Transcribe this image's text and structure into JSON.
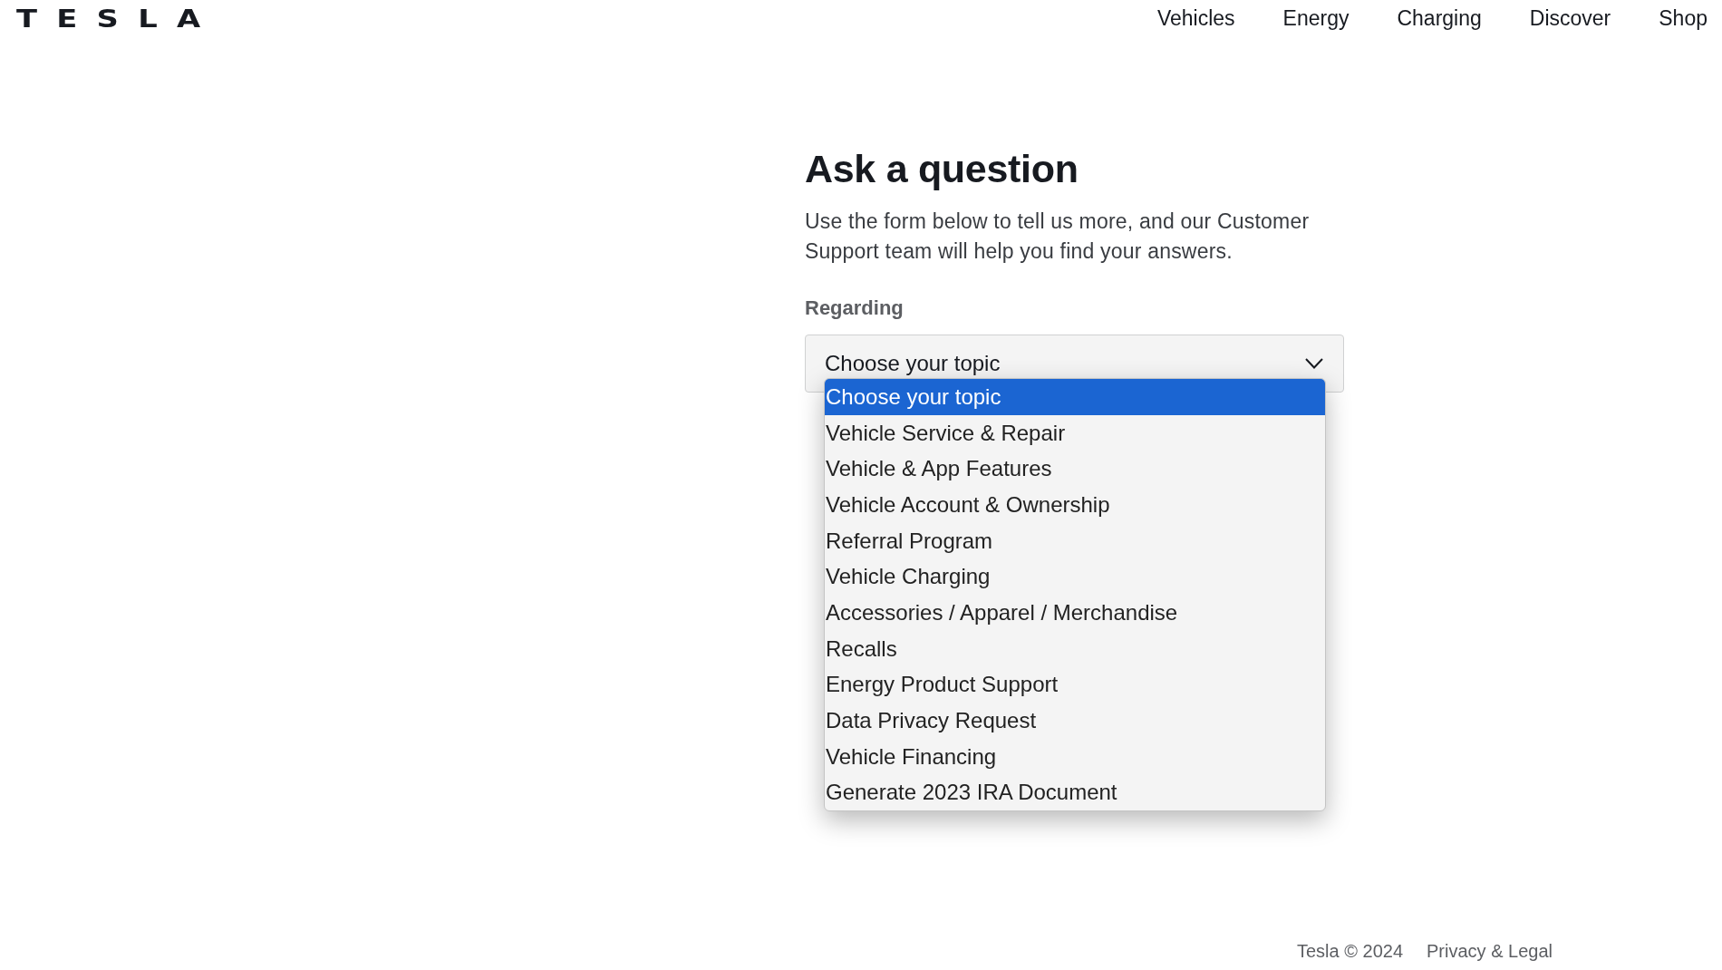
{
  "logo": {
    "text": "TESLA"
  },
  "nav": [
    "Vehicles",
    "Energy",
    "Charging",
    "Discover",
    "Shop"
  ],
  "form": {
    "title": "Ask a question",
    "description": "Use the form below to tell us more, and our Customer Support team will help you find your answers.",
    "field": {
      "label": "Regarding",
      "value": "Choose your topic",
      "expanded": true,
      "options": [
        {
          "label": "Choose your topic",
          "selected": true
        },
        {
          "label": "Vehicle Service & Repair",
          "selected": false
        },
        {
          "label": "Vehicle & App Features",
          "selected": false
        },
        {
          "label": "Vehicle Account & Ownership",
          "selected": false
        },
        {
          "label": "Referral Program",
          "selected": false
        },
        {
          "label": "Vehicle Charging",
          "selected": false
        },
        {
          "label": "Accessories / Apparel / Merchandise",
          "selected": false
        },
        {
          "label": "Recalls",
          "selected": false
        },
        {
          "label": "Energy Product Support",
          "selected": false
        },
        {
          "label": "Data Privacy Request",
          "selected": false
        },
        {
          "label": "Vehicle Financing",
          "selected": false
        },
        {
          "label": "Generate 2023 IRA Document",
          "selected": false
        }
      ]
    }
  },
  "footer": {
    "copyright": "Tesla © 2024",
    "links": [
      "Privacy & Legal"
    ]
  }
}
